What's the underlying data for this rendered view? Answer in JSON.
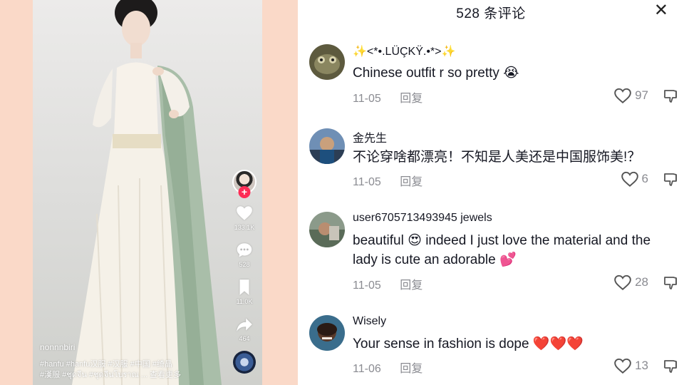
{
  "video": {
    "username": "nonnnbiri",
    "tags_line1": "#hanfu #hanfu汉服 #汉服 #中国 #绮晶",
    "tags_line2": "#漢服 #ชุดจีน #ชุดจีนโบราณ ...",
    "see_more": "查看更多",
    "likes": "133.1K",
    "comments": "528",
    "saves": "11.0K",
    "shares": "464"
  },
  "comments_panel": {
    "title": "528 条评论",
    "close_icon": "close-icon",
    "comments": [
      {
        "user": "✨<*•.LÜÇKŸ.•*>✨",
        "text": "Chinese outfit r so pretty 😭",
        "date": "11-05",
        "reply": "回复",
        "likes": "97"
      },
      {
        "user": "金先生",
        "text": "不论穿啥都漂亮！不知是人美还是中国服饰美!？",
        "date": "11-05",
        "reply": "回复",
        "likes": "6"
      },
      {
        "user": "user6705713493945 jewels",
        "text": "beautiful 😍 indeed I just love the material and the lady is cute an adorable 💕",
        "date": "11-05",
        "reply": "回复",
        "likes": "28"
      },
      {
        "user": "Wisely",
        "text": "Your sense in fashion is dope ❤️❤️❤️",
        "date": "11-06",
        "reply": "回复",
        "likes": "13"
      }
    ]
  },
  "colors": {
    "background": "#fad9c8",
    "accent_red": "#fe2c55",
    "muted_text": "#8a8b91"
  }
}
